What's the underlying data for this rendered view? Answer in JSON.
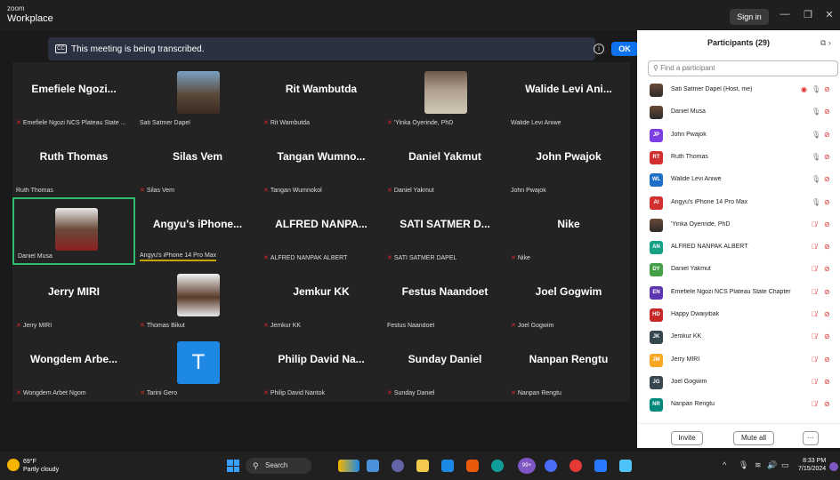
{
  "app": {
    "brand_line1": "zoom",
    "brand_line2": "Workplace",
    "sign_in": "Sign in"
  },
  "banner": {
    "text": "This meeting is being transcribed.",
    "ok": "OK"
  },
  "tiles": [
    {
      "big": "Emefiele  Ngozi...",
      "label": "Emefiele Ngozi NCS Plateau State ...",
      "muted": true
    },
    {
      "big": "",
      "label": "Sati Satmer Dapel",
      "muted": false,
      "photo": "a"
    },
    {
      "big": "Rit Wambutda",
      "label": "Rit Wambutda",
      "muted": true
    },
    {
      "big": "",
      "label": "'Yinka Oyerinde, PhD",
      "muted": true,
      "photo": "b"
    },
    {
      "big": "Walide Levi Ani...",
      "label": "Walide Levi Aniwe",
      "muted": false
    },
    {
      "big": "Ruth Thomas",
      "label": "Ruth Thomas",
      "muted": false
    },
    {
      "big": "Silas Vem",
      "label": "Silas Vem",
      "muted": true
    },
    {
      "big": "Tangan  Wumno...",
      "label": "Tangan Wumnokol",
      "muted": true
    },
    {
      "big": "Daniel Yakmut",
      "label": "Daniel Yakmut",
      "muted": true
    },
    {
      "big": "John Pwajok",
      "label": "John Pwajok",
      "muted": false
    },
    {
      "big": "",
      "label": "Daniel Musa",
      "muted": false,
      "photo": "c",
      "active": true
    },
    {
      "big": "Angyu's iPhone...",
      "label": "Angyu's iPhone 14 Pro Max",
      "muted": false,
      "underline": true
    },
    {
      "big": "ALFRED  NANPA...",
      "label": "ALFRED NANPAK ALBERT",
      "muted": true
    },
    {
      "big": "SATI  SATMER  D...",
      "label": "SATI SATMER DAPEL",
      "muted": true
    },
    {
      "big": "Nike",
      "label": "Nike",
      "muted": true
    },
    {
      "big": "Jerry MIRI",
      "label": "Jerry MIRI",
      "muted": true
    },
    {
      "big": "",
      "label": "Thomas Bikut",
      "muted": true,
      "photo": "d"
    },
    {
      "big": "Jemkur KK",
      "label": "Jemkur KK",
      "muted": true
    },
    {
      "big": "Festus Naandoet",
      "label": "Festus Naandoet",
      "muted": false
    },
    {
      "big": "Joel Gogwim",
      "label": "Joel Gogwim",
      "muted": true
    },
    {
      "big": "Wongdem  Arbe...",
      "label": "Wongdem Arbet Ngom",
      "muted": true
    },
    {
      "big": "",
      "label": "Tarini Gero",
      "muted": true,
      "avatar": "T"
    },
    {
      "big": "Philip  David  Na...",
      "label": "Philip David Nantok",
      "muted": true
    },
    {
      "big": "Sunday Daniel",
      "label": "Sunday Daniel",
      "muted": true
    },
    {
      "big": "Nanpan Rengtu",
      "label": "Nanpan Rengtu",
      "muted": true
    }
  ],
  "participants": {
    "title": "Participants (29)",
    "search_placeholder": "Find a participant",
    "list": [
      {
        "name": "Sati Satmer Dapel (Host, me)",
        "initials": "",
        "color": "",
        "muted": false,
        "rec": true
      },
      {
        "name": "Daniel Musa",
        "initials": "",
        "color": "",
        "muted": false
      },
      {
        "name": "John Pwajok",
        "initials": "JP",
        "color": "#7b3fe4",
        "muted": false
      },
      {
        "name": "Ruth Thomas",
        "initials": "RT",
        "color": "#d32f2f",
        "muted": false
      },
      {
        "name": "Walide Levi Aniwe",
        "initials": "WL",
        "color": "#1e6fc8",
        "muted": false
      },
      {
        "name": "Angyu's iPhone 14 Pro Max",
        "initials": "AI",
        "color": "#d32f2f",
        "muted": false
      },
      {
        "name": "'Yinka Oyerinde, PhD",
        "initials": "",
        "color": "",
        "muted": true
      },
      {
        "name": "ALFRED NANPAK ALBERT",
        "initials": "AN",
        "color": "#16a085",
        "muted": true
      },
      {
        "name": "Daniel Yakmut",
        "initials": "DY",
        "color": "#43a047",
        "muted": true
      },
      {
        "name": "Emefiele Ngozi NCS Plateau State Chapter",
        "initials": "EN",
        "color": "#5e35b1",
        "muted": true
      },
      {
        "name": "Happy Dwaiyibak",
        "initials": "HD",
        "color": "#c62828",
        "muted": true
      },
      {
        "name": "Jemkur KK",
        "initials": "JK",
        "color": "#37474f",
        "muted": true
      },
      {
        "name": "Jerry MIRI",
        "initials": "JM",
        "color": "#f9a825",
        "muted": true
      },
      {
        "name": "Joel Gogwim",
        "initials": "JG",
        "color": "#37474f",
        "muted": true
      },
      {
        "name": "Nanpan Rengtu",
        "initials": "NR",
        "color": "#00897b",
        "muted": true
      }
    ],
    "invite": "Invite",
    "mute_all": "Mute all",
    "more": "···"
  },
  "taskbar": {
    "temp": "69°F",
    "weather": "Partly cloudy",
    "search": "Search",
    "badge": "99+",
    "time": "8:33 PM",
    "date": "7/15/2024"
  }
}
